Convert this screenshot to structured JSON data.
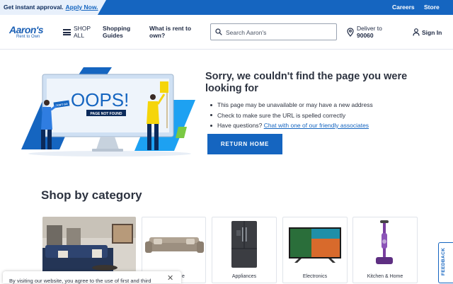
{
  "promo": {
    "text": "Get instant approval.",
    "link": "Apply Now.",
    "careers": "Careers",
    "store": "Store"
  },
  "header": {
    "logo_main": "Aaron's",
    "logo_sub": "Rent to Own",
    "shop_all_line1": "SHOP",
    "shop_all_line2": "ALL",
    "shopping_guides_line1": "Shopping",
    "shopping_guides_line2": "Guides",
    "what_is_rent_line1": "What is rent to",
    "what_is_rent_line2": "own?",
    "search_placeholder": "Search Aaron's",
    "deliver_label": "Deliver to",
    "deliver_zip": "90060",
    "sign_in": "Sign In"
  },
  "error": {
    "oops": "OOPS!",
    "page_not_found": "PAGE NOT FOUND",
    "dont_go": "DON'T GO",
    "title": "Sorry, we couldn't find the page you were looking for",
    "bullet1": "This page may be unavailable or may have a new address",
    "bullet2": "Check to make sure the URL is spelled correctly",
    "bullet3_prefix": "Have questions? ",
    "bullet3_link": "Chat with one of our friendly associates",
    "return_button": "RETURN HOME"
  },
  "categories": {
    "heading": "Shop by category",
    "items": [
      {
        "label": ""
      },
      {
        "label": "e"
      },
      {
        "label": "Appliances"
      },
      {
        "label": "Electronics"
      },
      {
        "label": "Kitchen & Home"
      }
    ]
  },
  "cookie": {
    "text": "By visiting our website, you agree to the use of first and third"
  },
  "feedback": {
    "label": "FEEDBACK"
  },
  "colors": {
    "brand_blue": "#1565c0",
    "illustration_light_blue": "#1da1f2",
    "figure_yellow": "#f5d50a"
  }
}
